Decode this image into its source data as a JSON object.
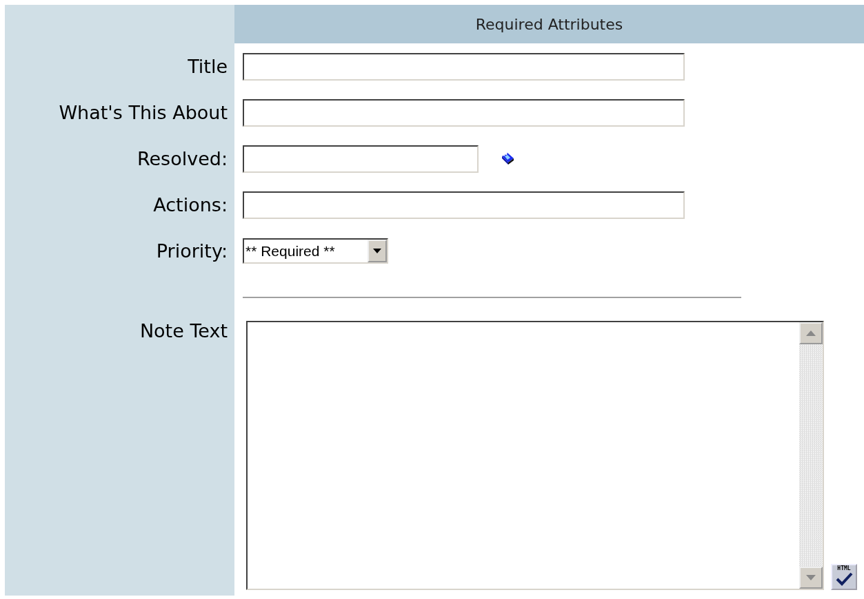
{
  "header": "Required Attributes",
  "fields": [
    {
      "kind": "text",
      "label": "Title"
    },
    {
      "kind": "text",
      "label": "What's This About"
    },
    {
      "kind": "date",
      "label": "Resolved:"
    },
    {
      "kind": "text",
      "label": "Actions:"
    },
    {
      "kind": "select",
      "label": "Priority:",
      "value": "** Required **"
    }
  ],
  "note": {
    "label": "Note Text"
  },
  "html_button": {
    "label": "HTML"
  }
}
